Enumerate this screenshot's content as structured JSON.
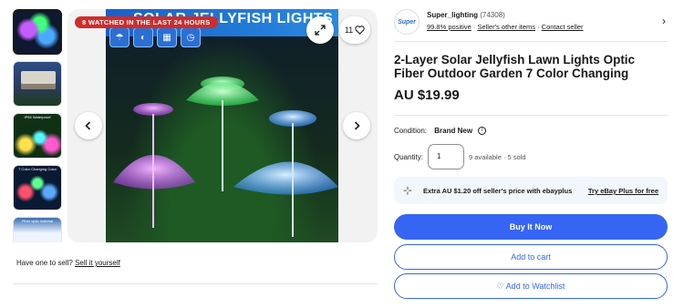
{
  "gallery": {
    "thumbnails": [
      {
        "label": ""
      },
      {
        "label": ""
      },
      {
        "label": "IP65 Waterproof"
      },
      {
        "label": "7 Color Changing Color"
      },
      {
        "label": "Fiber optic material"
      }
    ],
    "watch_banner": "8 WATCHED IN THE LAST 24 HOURS",
    "image_title": "SOLAR JELLYFISH LIGHTS",
    "watch_count": "11",
    "sell_prompt": "Have one to sell?",
    "sell_link": "Sell it yourself"
  },
  "seller": {
    "logo_text": "Super",
    "name": "Super_lighting",
    "feedback_count": "(74308)",
    "positive": "99.8% positive",
    "other_items": "Seller's other items",
    "contact": "Contact seller"
  },
  "listing": {
    "title": "2-Layer Solar Jellyfish Lawn Lights Optic Fiber Outdoor Garden 7 Color Changing",
    "price": "AU $19.99",
    "condition_label": "Condition:",
    "condition_value": "Brand New",
    "quantity_label": "Quantity:",
    "quantity_value": "1",
    "availability": "9 available · 5 sold"
  },
  "ebay_plus": {
    "text": "Extra AU $1.20 off seller's price with ebayplus",
    "link": "Try eBay Plus for free"
  },
  "actions": {
    "buy": "Buy It Now",
    "cart": "Add to cart",
    "watch": "♡ Add to Watchlist"
  },
  "colors": {
    "accent": "#3665f3",
    "watch_banner": "#d02c2c",
    "plus_bg": "#f2f6fd"
  }
}
